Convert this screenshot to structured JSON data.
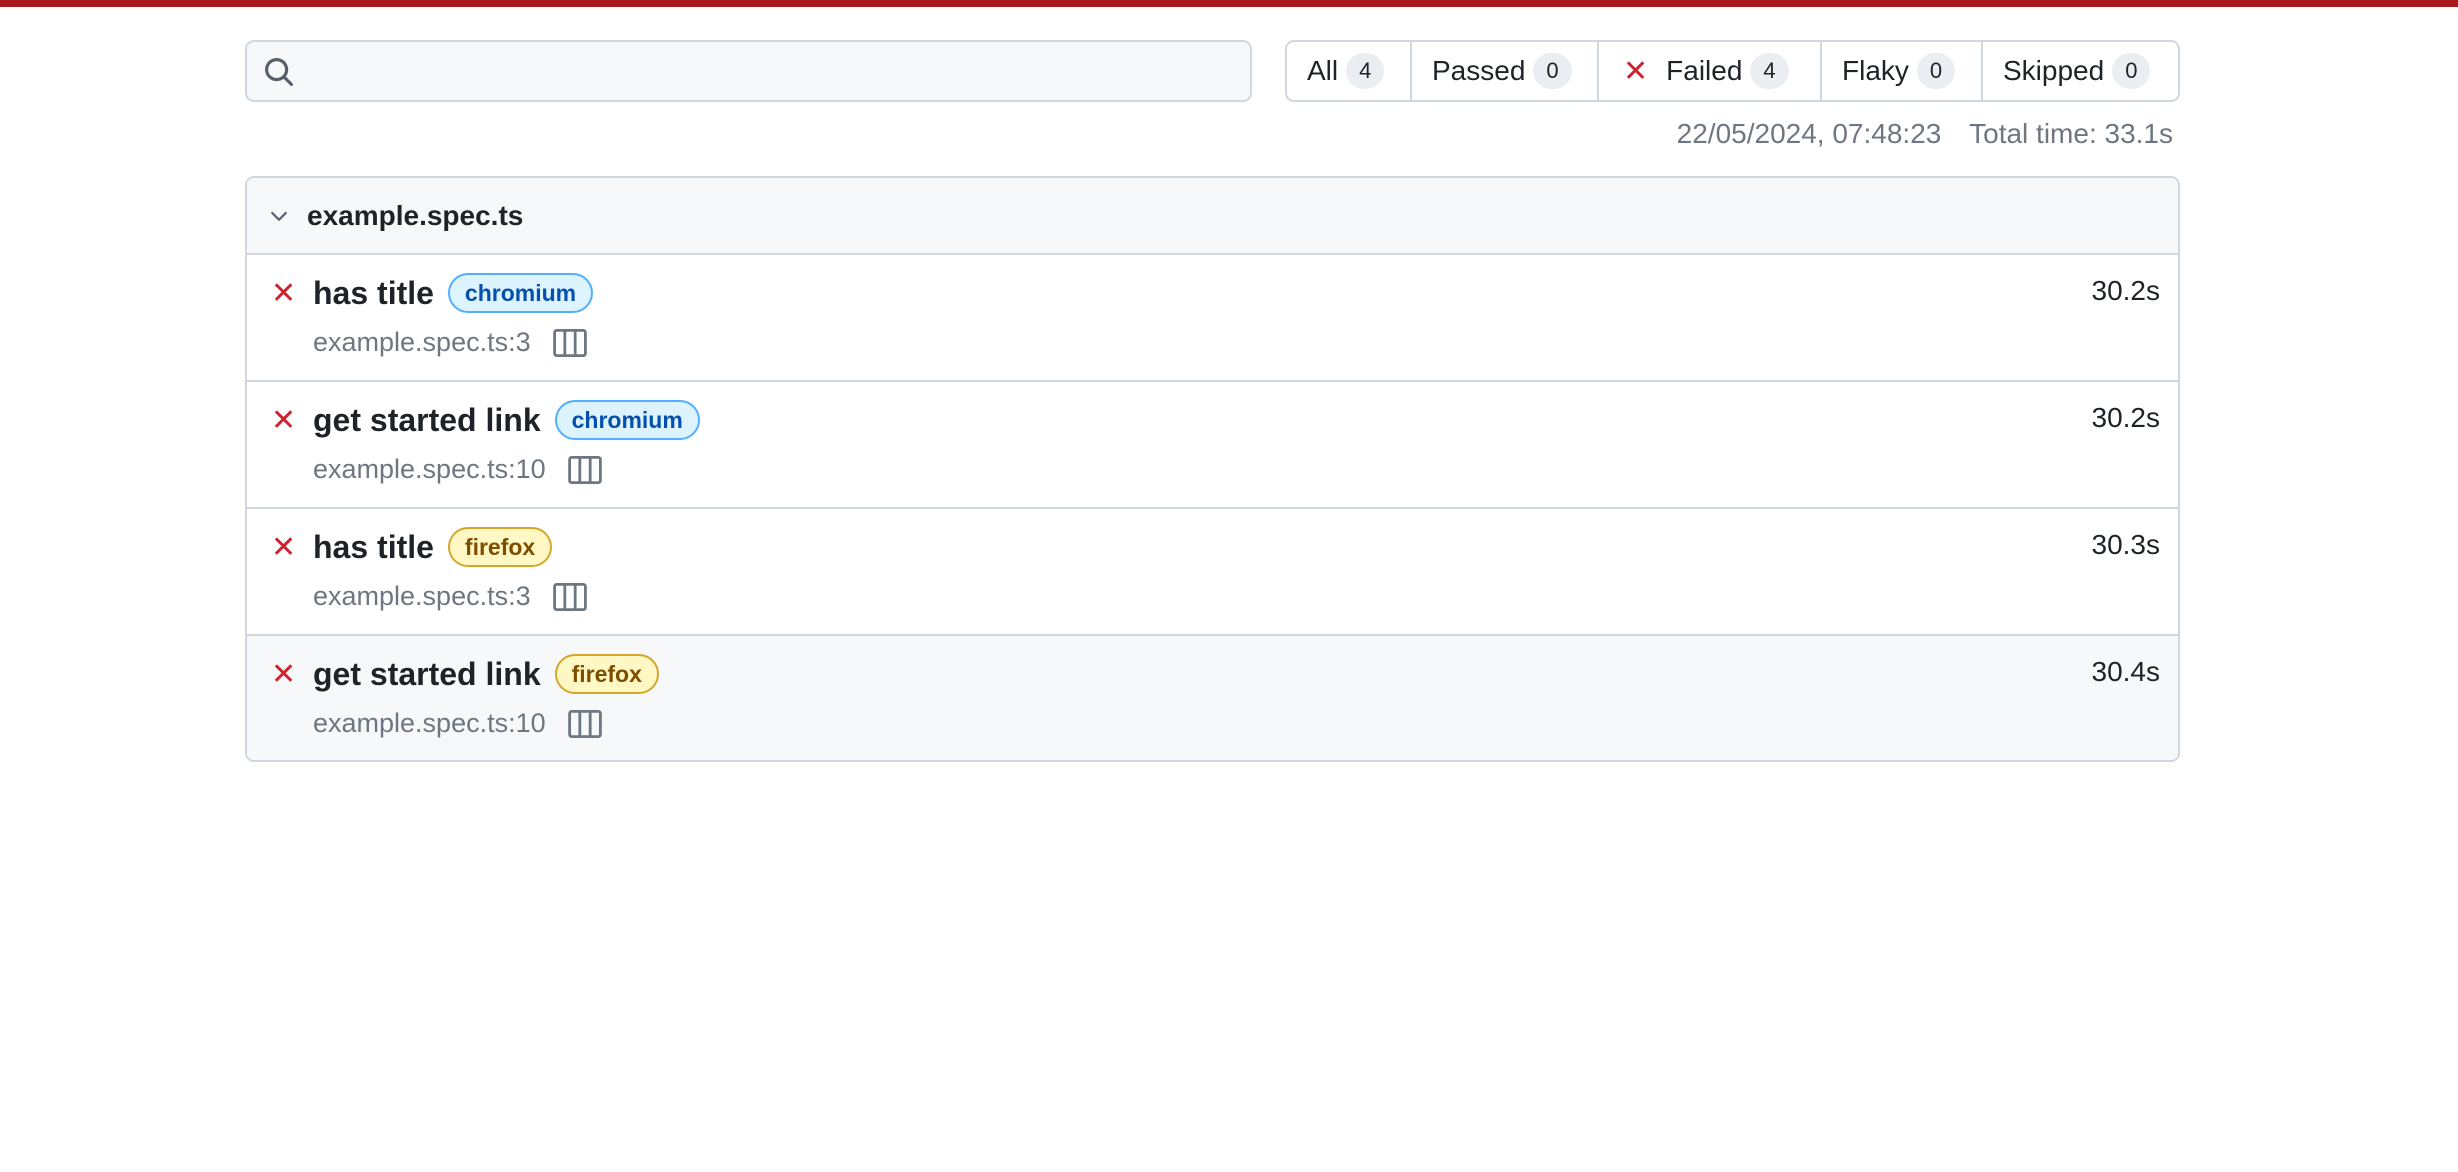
{
  "colors": {
    "top_bar": "#a8191b",
    "failed": "#cf222e",
    "chromium_badge_bg": "#ddf4ff",
    "chromium_badge_fg": "#0550ae",
    "firefox_badge_bg": "#fff8c5",
    "firefox_badge_fg": "#7d4e00"
  },
  "search": {
    "value": "",
    "placeholder": "",
    "icon": "search-icon"
  },
  "filters": [
    {
      "label": "All",
      "count": "4"
    },
    {
      "label": "Passed",
      "count": "0"
    },
    {
      "label": "Failed",
      "count": "4",
      "icon": "x-icon"
    },
    {
      "label": "Flaky",
      "count": "0"
    },
    {
      "label": "Skipped",
      "count": "0"
    }
  ],
  "run": {
    "timestamp": "22/05/2024, 07:48:23",
    "total_time": "Total time: 33.1s"
  },
  "suite": {
    "name": "example.spec.ts",
    "expanded_icon": "chevron-down-icon",
    "tests": [
      {
        "status": "failed",
        "status_glyph": "✕",
        "title": "has title",
        "project": "chromium",
        "location": "example.spec.ts:3",
        "duration": "30.2s"
      },
      {
        "status": "failed",
        "status_glyph": "✕",
        "title": "get started link",
        "project": "chromium",
        "location": "example.spec.ts:10",
        "duration": "30.2s"
      },
      {
        "status": "failed",
        "status_glyph": "✕",
        "title": "has title",
        "project": "firefox",
        "location": "example.spec.ts:3",
        "duration": "30.3s"
      },
      {
        "status": "failed",
        "status_glyph": "✕",
        "title": "get started link",
        "project": "firefox",
        "location": "example.spec.ts:10",
        "duration": "30.4s"
      }
    ]
  },
  "filter_failed_glyph": "✕"
}
